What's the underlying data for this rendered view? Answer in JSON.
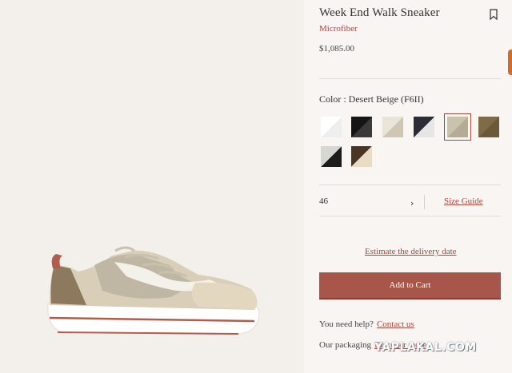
{
  "product": {
    "title": "Week End Walk Sneaker",
    "material": "Microfiber",
    "price": "$1,085.00"
  },
  "colors": {
    "label": "Color : Desert Beige (F6II)",
    "selected_index": 4,
    "swatches": [
      {
        "name": "white",
        "colors": [
          "#ffffff",
          "#eeeeee"
        ]
      },
      {
        "name": "black",
        "colors": [
          "#151515",
          "#3a3a3a"
        ]
      },
      {
        "name": "beige-white",
        "colors": [
          "#e9e4d8",
          "#cfc6b3"
        ]
      },
      {
        "name": "navy-white",
        "colors": [
          "#2a2d35",
          "#e6e6e6"
        ]
      },
      {
        "name": "desert-beige",
        "colors": [
          "#cbc2ad",
          "#b5ab94"
        ]
      },
      {
        "name": "olive-brown",
        "colors": [
          "#7e6b47",
          "#6a5a3b"
        ]
      },
      {
        "name": "grey-black",
        "colors": [
          "#d6d6d2",
          "#1c1c1c"
        ]
      },
      {
        "name": "brown-cream",
        "colors": [
          "#4a3426",
          "#e8dcc6"
        ]
      }
    ]
  },
  "size": {
    "value": "46",
    "guide_label": "Size Guide"
  },
  "delivery": {
    "estimate_label": "Estimate the delivery date"
  },
  "cart": {
    "button_label": "Add to Cart"
  },
  "help": {
    "text": "You need help?",
    "link": "Contact us"
  },
  "packaging": {
    "text": "Our packaging",
    "link": "Discover more"
  },
  "watermark": "YAPLAKAL.COM",
  "accent_color": "#a5463c"
}
